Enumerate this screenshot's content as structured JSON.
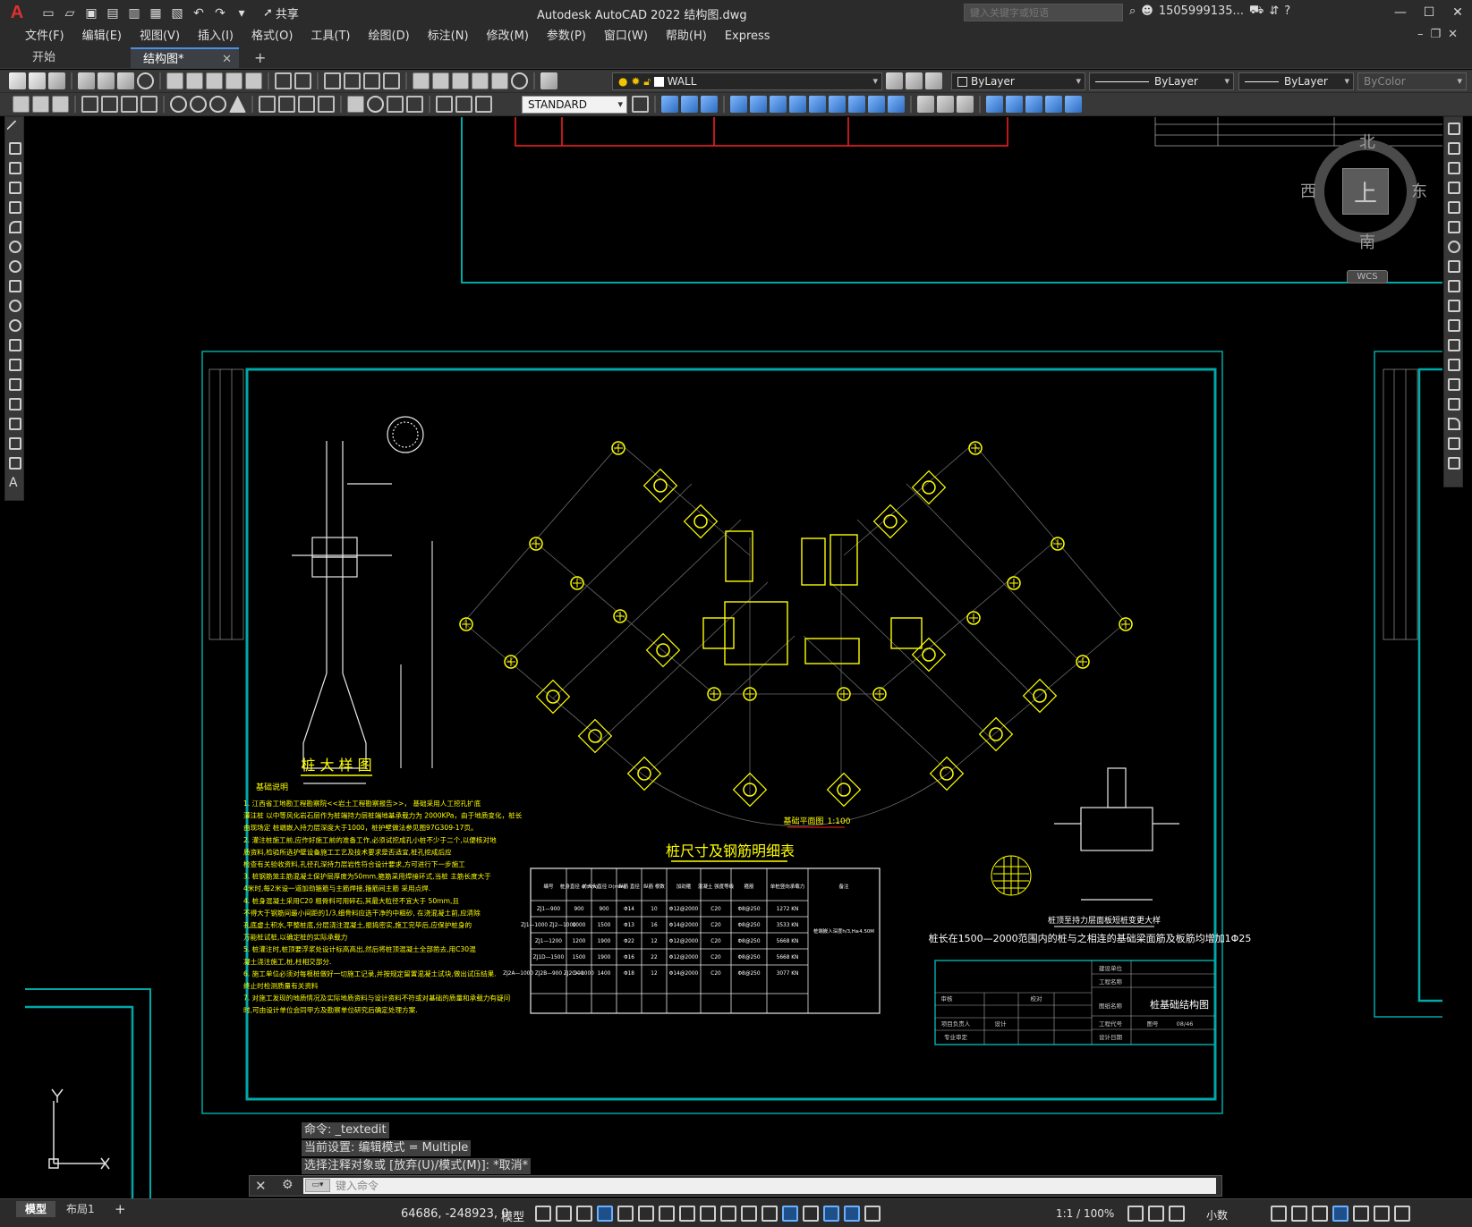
{
  "app": {
    "logo": "A",
    "title": "Autodesk AutoCAD 2022    结构图.dwg",
    "share_label": "共享",
    "search_placeholder": "键入关键字或短语",
    "user": "1505999135...",
    "help": "?"
  },
  "menu": [
    "文件(F)",
    "编辑(E)",
    "视图(V)",
    "插入(I)",
    "格式(O)",
    "工具(T)",
    "绘图(D)",
    "标注(N)",
    "修改(M)",
    "参数(P)",
    "窗口(W)",
    "帮助(H)",
    "Express"
  ],
  "tabs": {
    "start": "开始",
    "drawing": "结构图*",
    "close": "✕",
    "add": "+"
  },
  "toolbar": {
    "layer_name": "WALL",
    "color": "ByLayer",
    "linetype": "ByLayer",
    "lineweight": "ByLayer",
    "plotstyle": "ByColor",
    "textstyle": "STANDARD"
  },
  "viewcube": {
    "north": "北",
    "south": "南",
    "east": "东",
    "west": "西",
    "top": "上",
    "wcs": "WCS"
  },
  "drawing": {
    "pile_detail_title": "桩 大 样 图",
    "plan_title": "基础平面图",
    "plan_scale": "1:100",
    "table_title": "桩尺寸及钢筋明细表",
    "notes_title": "基础说明",
    "notes": [
      "1. 江西省工地勘工程勘察院<<岩土工程勘察报告>>，  基础采用人工挖孔扩底",
      "   灌注桩 以中等风化岩石层作为桩端持力层桩端地基承载力为 2000KPa，由于地质变化，桩长",
      "   由现场定 桩端嵌入持力层深度大于1000，桩护壁做法参见图97G309-17页。",
      "2. 灌注桩施工前,应作好施工前的准备工作,必须试挖成孔小桩不少于二个,以便核对地",
      "   质资料,检验所选护壁设备施工工艺及技术要求是否适宜,桩孔挖成后应",
      "   检查有关验收资料,孔径孔深持力层岩性符合设计要求,方可进行下一步施工",
      "3. 桩钢筋笼主筋混凝土保护层厚度为50mm,箍筋采用焊接环式,当桩 主筋长度大于",
      "   4米时,每2米设一道加劲箍筋与主筋焊接,箍筋间主筋 采用点焊.",
      "4. 桩身混凝土采用C20 粗骨料可用碎石,其最大粒径不宜大于  50mm,且",
      "   不得大于钢筋间最小间距的1/3,细骨料应选干净的中粗砂, 在浇混凝土前,应清除",
      "   孔底虚土积水,平整桩底,分层浇注混凝土,振捣密实,施工完毕后,应保护桩身的",
      "   万能桩试桩,以确定桩的实际承载力",
      "5. 桩灌注时,桩顶要浮浆处设计标高高出,然后将桩顶混凝土全部凿去,用C30混",
      "   凝土浇注施工,桩,柱相交部分.",
      "6. 施工单位必须对每根桩做好一切施工记录,并按规定留置混凝土试块,做出试压结果.",
      "   终止时检测质量有关资料",
      "7. 对施工发现的地质情况及实际地质资料与设计资料不符或对基础的质量和承载力有疑问",
      "   时,可由设计单位会同甲方及勘察单位研究后确定处理方案."
    ],
    "table_headers": [
      "编号",
      "桩身直径 d(mm)",
      "扩大头直径 D(mm)",
      "纵筋 直径",
      "纵筋 根数",
      "加劲箍",
      "混凝土 强度等级",
      "箍筋",
      "单桩竖向承载力",
      "备注"
    ],
    "table_rows": [
      [
        "ZJ1—900",
        "900",
        "900",
        "Φ14",
        "10",
        "Φ12@2000",
        "C20",
        "Φ8@250",
        "1272 KN"
      ],
      [
        "ZJ1—1000 ZJ2—1000",
        "1000",
        "1500",
        "Φ13",
        "16",
        "Φ14@2000",
        "C20",
        "Φ8@250",
        "3533 KN"
      ],
      [
        "ZJ1—1200",
        "1200",
        "1900",
        "Φ22",
        "12",
        "Φ12@2000",
        "C20",
        "Φ8@250",
        "5668 KN"
      ],
      [
        "ZJ1D—1500",
        "1500",
        "1900",
        "Φ16",
        "22",
        "Φ12@2000",
        "C20",
        "Φ8@250",
        "5668 KN"
      ],
      [
        "ZJ2A—1000 ZJ2B—900 ZJ2C—1000",
        "900",
        "1400",
        "Φ18",
        "12",
        "Φ14@2000",
        "C20",
        "Φ8@250",
        "3077 KN"
      ]
    ],
    "table_remark": "桩端嵌入深度h/3,H≥4.50M",
    "detail_caption": "桩顶至持力层面板短桩变更大样",
    "detail_note": "桩长在1500—2000范围内的桩与之相连的基础梁面筋及板筋均增加1Φ25",
    "title_block_name": "桩基础结构图",
    "title_block_labels": [
      "建设单位",
      "工程名称",
      "图纸名称",
      "工程代号",
      "设计日期",
      "审核",
      "设计",
      "校对",
      "项目负责人",
      "专业审定",
      "图号",
      "08/46"
    ]
  },
  "command": {
    "history": [
      "命令: _textedit",
      "当前设置: 编辑模式 = Multiple",
      "选择注释对象或 [放弃(U)/模式(M)]: *取消*"
    ],
    "placeholder": "键入命令"
  },
  "status": {
    "model_tab": "模型",
    "layout_tab": "布局1",
    "add_tab": "+",
    "coords": "64686, -248923, 0",
    "space": "模型",
    "scale": "1:1 / 100%",
    "units": "小数"
  },
  "colors": {
    "accent": "#4a8fe7",
    "drawing_yellow": "#ffff00",
    "drawing_cyan": "#00a8a8",
    "drawing_red": "#ff2020"
  }
}
